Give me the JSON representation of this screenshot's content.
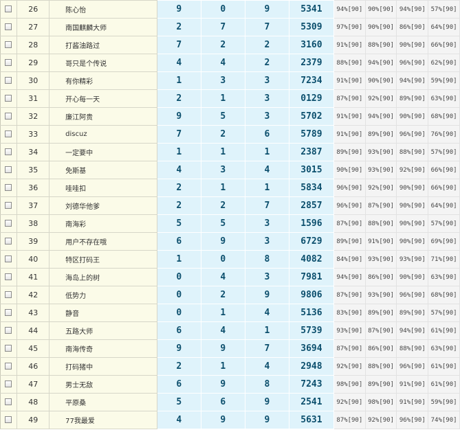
{
  "rows": [
    {
      "num": "26",
      "name": "陈心怡",
      "a": "9",
      "b": "0",
      "c": "9",
      "code": "5341",
      "p1": "94%[90]",
      "p2": "90%[90]",
      "p3": "94%[90]",
      "p4": "57%[90]"
    },
    {
      "num": "27",
      "name": "南国麒麟大师",
      "a": "2",
      "b": "7",
      "c": "7",
      "code": "5309",
      "p1": "97%[90]",
      "p2": "90%[90]",
      "p3": "86%[90]",
      "p4": "64%[90]"
    },
    {
      "num": "28",
      "name": "打酱油路过",
      "a": "7",
      "b": "2",
      "c": "2",
      "code": "3160",
      "p1": "91%[90]",
      "p2": "88%[90]",
      "p3": "90%[90]",
      "p4": "66%[90]"
    },
    {
      "num": "29",
      "name": "哥只是个传说",
      "a": "4",
      "b": "4",
      "c": "2",
      "code": "2379",
      "p1": "88%[90]",
      "p2": "94%[90]",
      "p3": "96%[90]",
      "p4": "62%[90]"
    },
    {
      "num": "30",
      "name": "有你精彩",
      "a": "1",
      "b": "3",
      "c": "3",
      "code": "7234",
      "p1": "91%[90]",
      "p2": "90%[90]",
      "p3": "94%[90]",
      "p4": "59%[90]"
    },
    {
      "num": "31",
      "name": "开心每一天",
      "a": "2",
      "b": "1",
      "c": "3",
      "code": "0129",
      "p1": "87%[90]",
      "p2": "92%[90]",
      "p3": "89%[90]",
      "p4": "63%[90]"
    },
    {
      "num": "32",
      "name": "廉江阿贵",
      "a": "9",
      "b": "5",
      "c": "3",
      "code": "5702",
      "p1": "91%[90]",
      "p2": "94%[90]",
      "p3": "90%[90]",
      "p4": "68%[90]"
    },
    {
      "num": "33",
      "name": "discuz",
      "a": "7",
      "b": "2",
      "c": "6",
      "code": "5789",
      "p1": "91%[90]",
      "p2": "89%[90]",
      "p3": "96%[90]",
      "p4": "76%[90]"
    },
    {
      "num": "34",
      "name": "一定要中",
      "a": "1",
      "b": "1",
      "c": "1",
      "code": "2387",
      "p1": "89%[90]",
      "p2": "93%[90]",
      "p3": "88%[90]",
      "p4": "57%[90]"
    },
    {
      "num": "35",
      "name": "免斯基",
      "a": "4",
      "b": "3",
      "c": "4",
      "code": "3015",
      "p1": "90%[90]",
      "p2": "93%[90]",
      "p3": "92%[90]",
      "p4": "66%[90]"
    },
    {
      "num": "36",
      "name": "哇哇扣",
      "a": "2",
      "b": "1",
      "c": "1",
      "code": "5834",
      "p1": "96%[90]",
      "p2": "92%[90]",
      "p3": "90%[90]",
      "p4": "66%[90]"
    },
    {
      "num": "37",
      "name": "刘德华他爹",
      "a": "2",
      "b": "2",
      "c": "7",
      "code": "2857",
      "p1": "96%[90]",
      "p2": "87%[90]",
      "p3": "90%[90]",
      "p4": "64%[90]"
    },
    {
      "num": "38",
      "name": "南海彩",
      "a": "5",
      "b": "5",
      "c": "3",
      "code": "1596",
      "p1": "87%[90]",
      "p2": "88%[90]",
      "p3": "90%[90]",
      "p4": "57%[90]"
    },
    {
      "num": "39",
      "name": "用户不存在哦",
      "a": "6",
      "b": "9",
      "c": "3",
      "code": "6729",
      "p1": "89%[90]",
      "p2": "91%[90]",
      "p3": "90%[90]",
      "p4": "69%[90]"
    },
    {
      "num": "40",
      "name": "特区打码王",
      "a": "1",
      "b": "0",
      "c": "8",
      "code": "4082",
      "p1": "84%[90]",
      "p2": "93%[90]",
      "p3": "93%[90]",
      "p4": "71%[90]"
    },
    {
      "num": "41",
      "name": "海岛上的树",
      "a": "0",
      "b": "4",
      "c": "3",
      "code": "7981",
      "p1": "94%[90]",
      "p2": "86%[90]",
      "p3": "90%[90]",
      "p4": "63%[90]"
    },
    {
      "num": "42",
      "name": "低势力",
      "a": "0",
      "b": "2",
      "c": "9",
      "code": "9806",
      "p1": "87%[90]",
      "p2": "93%[90]",
      "p3": "96%[90]",
      "p4": "68%[90]"
    },
    {
      "num": "43",
      "name": "静音",
      "a": "0",
      "b": "1",
      "c": "4",
      "code": "5136",
      "p1": "83%[90]",
      "p2": "89%[90]",
      "p3": "89%[90]",
      "p4": "57%[90]"
    },
    {
      "num": "44",
      "name": "五路大师",
      "a": "6",
      "b": "4",
      "c": "1",
      "code": "5739",
      "p1": "93%[90]",
      "p2": "87%[90]",
      "p3": "94%[90]",
      "p4": "61%[90]"
    },
    {
      "num": "45",
      "name": "南海传奇",
      "a": "9",
      "b": "9",
      "c": "7",
      "code": "3694",
      "p1": "87%[90]",
      "p2": "86%[90]",
      "p3": "88%[90]",
      "p4": "63%[90]"
    },
    {
      "num": "46",
      "name": "打码猪中",
      "a": "2",
      "b": "1",
      "c": "4",
      "code": "2948",
      "p1": "92%[90]",
      "p2": "88%[90]",
      "p3": "96%[90]",
      "p4": "61%[90]"
    },
    {
      "num": "47",
      "name": "男士无敌",
      "a": "6",
      "b": "9",
      "c": "8",
      "code": "7243",
      "p1": "98%[90]",
      "p2": "89%[90]",
      "p3": "91%[90]",
      "p4": "61%[90]"
    },
    {
      "num": "48",
      "name": "平原桑",
      "a": "5",
      "b": "6",
      "c": "9",
      "code": "2541",
      "p1": "92%[90]",
      "p2": "98%[90]",
      "p3": "91%[90]",
      "p4": "59%[90]"
    },
    {
      "num": "49",
      "name": "77我最爱",
      "a": "4",
      "b": "9",
      "c": "9",
      "code": "5631",
      "p1": "87%[90]",
      "p2": "92%[90]",
      "p3": "96%[90]",
      "p4": "74%[90]"
    }
  ]
}
